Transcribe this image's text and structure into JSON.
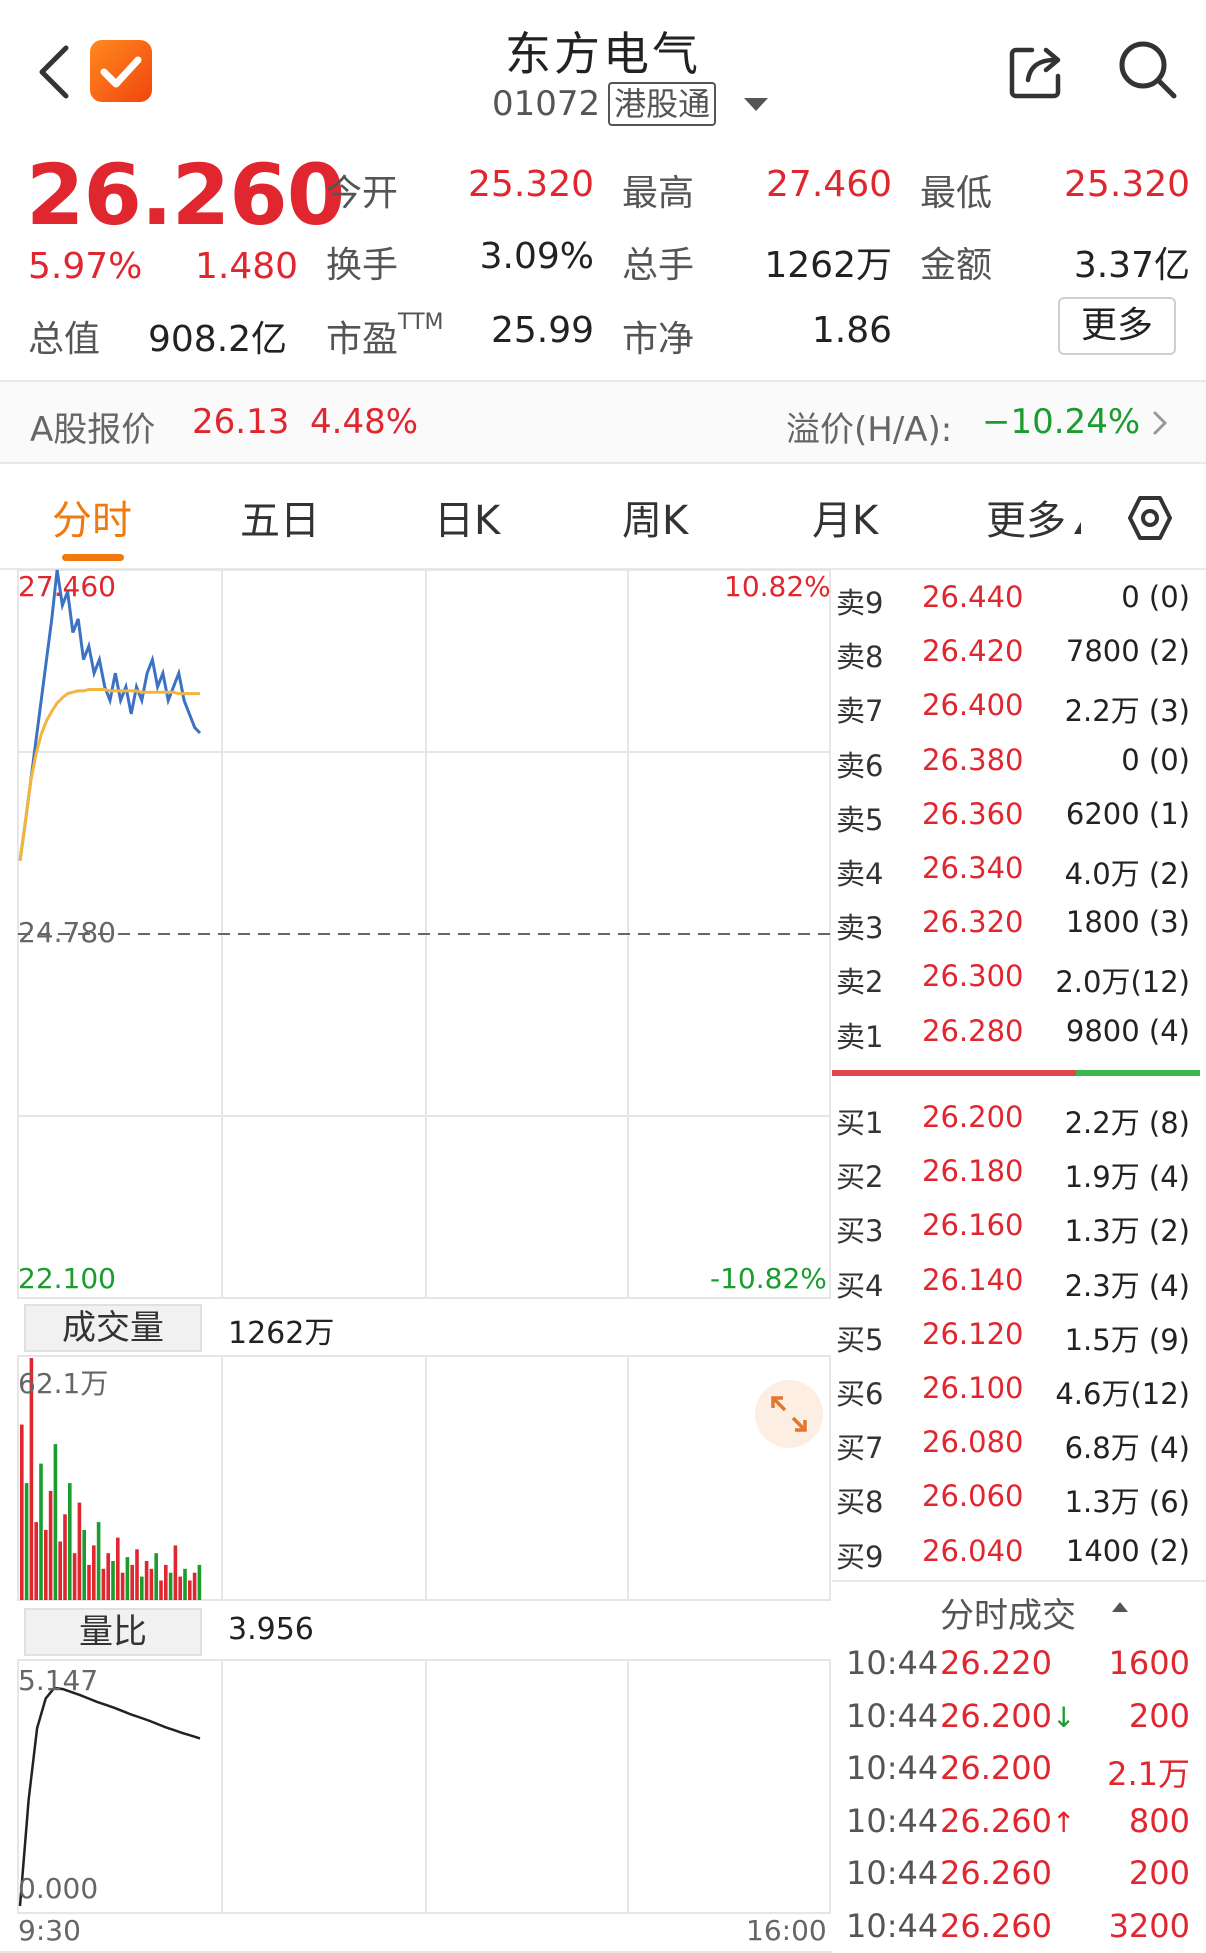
{
  "header": {
    "title": "东方电气",
    "code": "01072",
    "market_tag": "港股通"
  },
  "quote": {
    "price": "26.260",
    "change_pct": "5.97%",
    "change": "1.480",
    "total_label": "总值",
    "total_value": "908.2亿",
    "stats": [
      {
        "label": "今开",
        "value": "25.320",
        "color": "red"
      },
      {
        "label": "最高",
        "value": "27.460",
        "color": "red"
      },
      {
        "label": "最低",
        "value": "25.320",
        "color": "red"
      },
      {
        "label": "换手",
        "value": "3.09%",
        "color": "dark"
      },
      {
        "label": "总手",
        "value": "1262万",
        "color": "dark"
      },
      {
        "label": "金额",
        "value": "3.37亿",
        "color": "dark"
      },
      {
        "label": "市盈",
        "sup": "TTM",
        "value": "25.99",
        "color": "dark"
      },
      {
        "label": "市净",
        "value": "1.86",
        "color": "dark"
      }
    ],
    "more_label": "更多"
  },
  "a_share": {
    "label": "A股报价",
    "price": "26.13",
    "pct": "4.48%",
    "premium_label": "溢价(H/A):",
    "premium_value": "−10.24%"
  },
  "tabs": [
    "分时",
    "五日",
    "日K",
    "周K",
    "月K",
    "更多"
  ],
  "active_tab": 0,
  "chart": {
    "y_high": "27.460",
    "y_mid": "24.780",
    "y_low": "22.100",
    "pct_high": "10.82%",
    "pct_low": "-10.82%",
    "volume_label": "成交量",
    "volume_value": "1262万",
    "volume_max": "62.1万",
    "ratio_label": "量比",
    "ratio_value": "3.956",
    "ratio_max": "5.147",
    "ratio_min": "0.000",
    "time_start": "9:30",
    "time_end": "16:00",
    "colors": {
      "up": "#e0262e",
      "down": "#1a9c2e",
      "price_line": "#3b72c4",
      "avg_line": "#f3b53c"
    }
  },
  "chart_data": {
    "type": "line",
    "series": [
      {
        "values": [
          25.32,
          25.6,
          25.9,
          26.2,
          26.5,
          26.8,
          27.1,
          27.46,
          27.2,
          27.3,
          27.0,
          27.1,
          26.8,
          26.9,
          26.7,
          26.8,
          26.6,
          26.5,
          26.7,
          26.5,
          26.6,
          26.4,
          26.6,
          26.5,
          26.7,
          26.8,
          26.6,
          26.7,
          26.5,
          26.6,
          26.7,
          26.5,
          26.4,
          26.3,
          26.26
        ]
      },
      {
        "values": [
          25.32,
          25.6,
          25.9,
          26.1,
          26.25,
          26.35,
          26.42,
          26.48,
          26.52,
          26.55,
          26.56,
          26.57,
          26.57,
          26.58,
          26.58,
          26.58,
          26.58,
          26.57,
          26.57,
          26.57,
          26.57,
          26.57,
          26.57,
          26.56,
          26.56,
          26.56,
          26.56,
          26.56,
          26.56,
          26.56,
          26.55,
          26.55,
          26.55,
          26.55,
          26.55
        ]
      }
    ],
    "ylim": [
      22.1,
      27.46
    ],
    "volume": {
      "values": [
        45,
        30,
        62.1,
        20,
        35,
        18,
        28,
        40,
        15,
        22,
        30,
        12,
        25,
        18,
        9,
        14,
        20,
        8,
        12,
        10,
        16,
        7,
        11,
        9,
        13,
        6,
        10,
        8,
        12,
        5,
        9,
        7,
        14,
        6,
        8,
        5,
        7,
        9
      ],
      "ylim": [
        0,
        62.1
      ]
    },
    "ratio": {
      "values": [
        0.0,
        2.5,
        4.2,
        4.9,
        5.147,
        5.12,
        5.05,
        4.98,
        4.9,
        4.82,
        4.75,
        4.68,
        4.6,
        4.52,
        4.45,
        4.38,
        4.3,
        4.22,
        4.15,
        4.08,
        4.02,
        3.956
      ],
      "ylim": [
        0,
        5.147
      ]
    }
  },
  "order_book": {
    "asks": [
      {
        "level": "卖9",
        "price": "26.440",
        "vol": "0 (0)"
      },
      {
        "level": "卖8",
        "price": "26.420",
        "vol": "7800 (2)"
      },
      {
        "level": "卖7",
        "price": "26.400",
        "vol": "2.2万 (3)"
      },
      {
        "level": "卖6",
        "price": "26.380",
        "vol": "0 (0)"
      },
      {
        "level": "卖5",
        "price": "26.360",
        "vol": "6200 (1)"
      },
      {
        "level": "卖4",
        "price": "26.340",
        "vol": "4.0万 (2)"
      },
      {
        "level": "卖3",
        "price": "26.320",
        "vol": "1800 (3)"
      },
      {
        "level": "卖2",
        "price": "26.300",
        "vol": "2.0万(12)"
      },
      {
        "level": "卖1",
        "price": "26.280",
        "vol": "9800 (4)"
      }
    ],
    "bids": [
      {
        "level": "买1",
        "price": "26.200",
        "vol": "2.2万 (8)"
      },
      {
        "level": "买2",
        "price": "26.180",
        "vol": "1.9万 (4)"
      },
      {
        "level": "买3",
        "price": "26.160",
        "vol": "1.3万 (2)"
      },
      {
        "level": "买4",
        "price": "26.140",
        "vol": "2.3万 (4)"
      },
      {
        "level": "买5",
        "price": "26.120",
        "vol": "1.5万 (9)"
      },
      {
        "level": "买6",
        "price": "26.100",
        "vol": "4.6万(12)"
      },
      {
        "level": "买7",
        "price": "26.080",
        "vol": "6.8万 (4)"
      },
      {
        "level": "买8",
        "price": "26.060",
        "vol": "1.3万 (6)"
      },
      {
        "level": "买9",
        "price": "26.040",
        "vol": "1400 (2)"
      }
    ]
  },
  "ticks": {
    "title": "分时成交",
    "rows": [
      {
        "time": "10:44",
        "price": "26.220",
        "arrow": "",
        "vol": "1600"
      },
      {
        "time": "10:44",
        "price": "26.200",
        "arrow": "↓",
        "vol": "200"
      },
      {
        "time": "10:44",
        "price": "26.200",
        "arrow": "",
        "vol": "2.1万"
      },
      {
        "time": "10:44",
        "price": "26.260",
        "arrow": "↑",
        "vol": "800"
      },
      {
        "time": "10:44",
        "price": "26.260",
        "arrow": "",
        "vol": "200"
      },
      {
        "time": "10:44",
        "price": "26.260",
        "arrow": "",
        "vol": "3200"
      }
    ]
  }
}
